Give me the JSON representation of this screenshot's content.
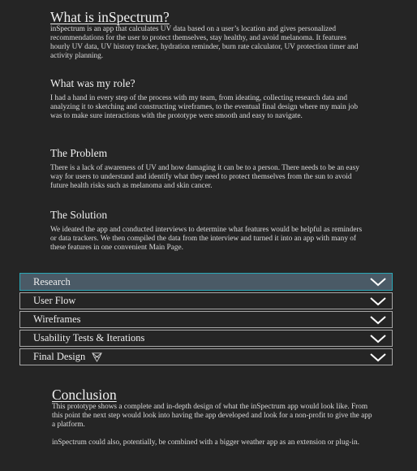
{
  "intro": {
    "title": "What is inSpectrum?",
    "body": "inSpectrum is an app that calculates UV data based on a user’s location and gives personalized recommendations for the user to protect themselves, stay healthy, and avoid melanoma. It features hourly UV data, UV history tracker, hydration reminder, burn rate calculator, UV protection timer and activity planning."
  },
  "role": {
    "title": "What was my role?",
    "body": "I had a hand in every step of the process with my team, from ideating, collecting research data and analyzing it to sketching and constructing wireframes, to the eventual final design where my main job was to make sure interactions with the prototype were smooth and easy to navigate."
  },
  "problem": {
    "title": "The Problem",
    "body": "There is a lack of awareness of UV and how damaging it can be to a person. There needs to be an easy way for users to understand and identify what they need to protect themselves from the sun to avoid future health risks such as melanoma and skin cancer."
  },
  "solution": {
    "title": "The Solution",
    "body": "We ideated the app and conducted interviews to determine what features would be helpful as reminders or data trackers. We then compiled the data from the interview and turned it into an app with many of these features in one convenient Main Page."
  },
  "accordion": [
    {
      "label": "Research",
      "icon": "chevron-down-icon"
    },
    {
      "label": "User Flow",
      "icon": "chevron-down-icon"
    },
    {
      "label": "Wireframes",
      "icon": "chevron-down-icon"
    },
    {
      "label": "Usability Tests & Iterations",
      "icon": "chevron-down-icon"
    },
    {
      "label": "Final Design",
      "icon": "chevron-down-icon",
      "extra_icon": "prototype-icon"
    }
  ],
  "colors": {
    "background": "#252525",
    "active_row": "#4a5a66",
    "active_border": "#2aa7b5"
  },
  "conclusion": {
    "title": "Conclusion",
    "body1": "This prototype shows a complete and in-depth design of what the inSpectrum app would look like. From this point the next step would look into having the app developed and look for a non-profit to give the app a platform.",
    "body2": "inSpectrum could also, potentially, be combined with a bigger weather app as an extension or plug-in."
  }
}
